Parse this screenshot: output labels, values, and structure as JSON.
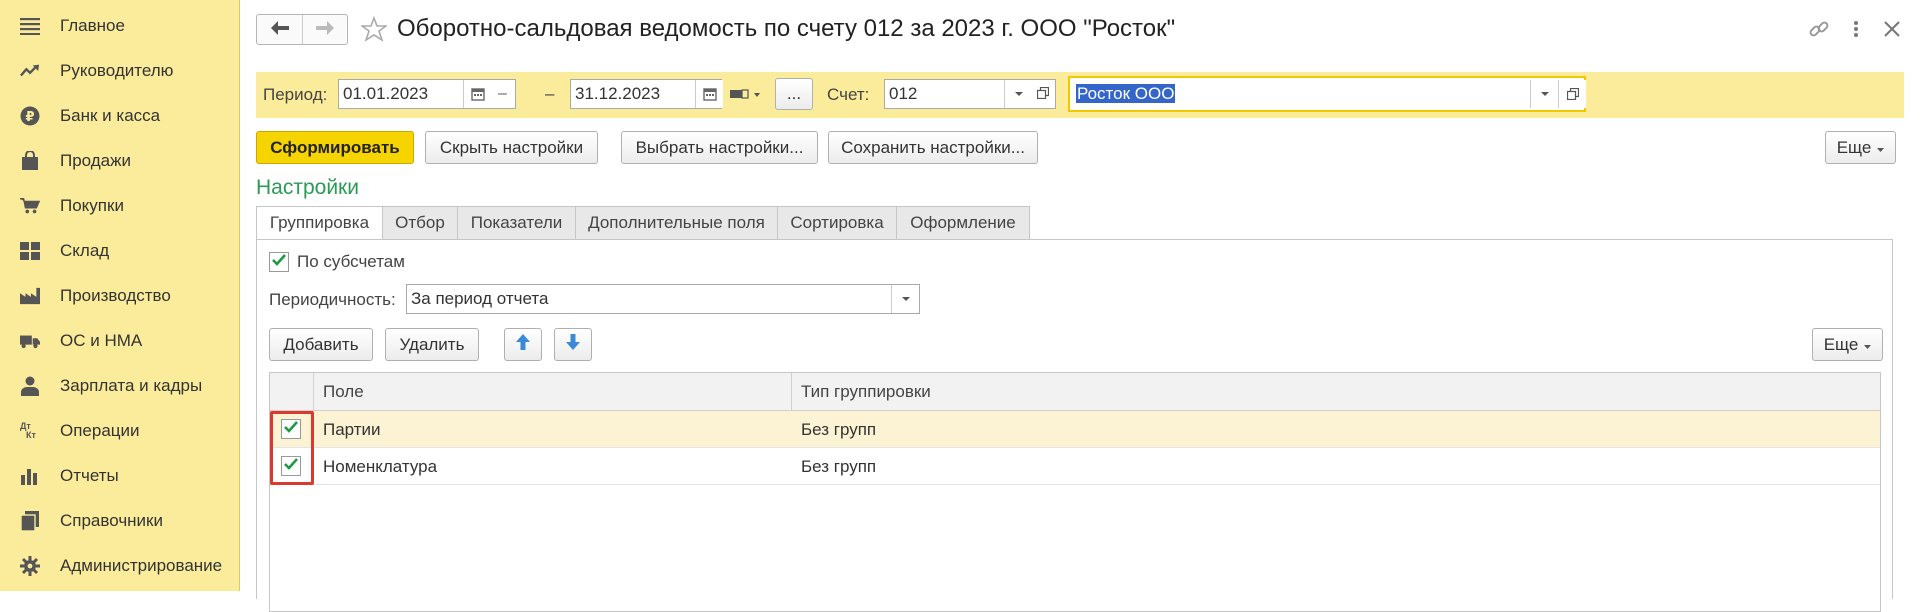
{
  "sidebar": {
    "items": [
      {
        "label": "Главное",
        "icon": "menu-lines-icon"
      },
      {
        "label": "Руководителю",
        "icon": "trend-up-icon"
      },
      {
        "label": "Банк и касса",
        "icon": "ruble-coin-icon"
      },
      {
        "label": "Продажи",
        "icon": "shopping-bag-icon"
      },
      {
        "label": "Покупки",
        "icon": "shopping-cart-icon"
      },
      {
        "label": "Склад",
        "icon": "warehouse-grid-icon"
      },
      {
        "label": "Производство",
        "icon": "factory-icon"
      },
      {
        "label": "ОС и НМА",
        "icon": "truck-icon"
      },
      {
        "label": "Зарплата и кадры",
        "icon": "person-icon"
      },
      {
        "label": "Операции",
        "icon": "dt-kt-icon"
      },
      {
        "label": "Отчеты",
        "icon": "bar-chart-icon"
      },
      {
        "label": "Справочники",
        "icon": "books-icon"
      },
      {
        "label": "Администрирование",
        "icon": "gear-icon"
      }
    ],
    "dt_label": "Дт",
    "kt_label": "Кт"
  },
  "header": {
    "title": "Оборотно-сальдовая ведомость по счету 012 за 2023 г. ООО \"Росток\""
  },
  "period": {
    "label": "Период:",
    "from": "01.01.2023",
    "dash": "–",
    "to": "31.12.2023",
    "ellipsis": "...",
    "account_label": "Счет:",
    "account": "012",
    "org": "Росток ООО"
  },
  "toolbar": {
    "generate": "Сформировать",
    "hide_settings": "Скрыть настройки",
    "choose_settings": "Выбрать настройки...",
    "save_settings": "Сохранить настройки...",
    "more": "Еще"
  },
  "settings": {
    "title": "Настройки",
    "tabs": [
      "Группировка",
      "Отбор",
      "Показатели",
      "Дополнительные поля",
      "Сортировка",
      "Оформление"
    ],
    "by_subaccounts": "По субсчетам",
    "periodicity_label": "Периодичность:",
    "periodicity_value": "За период отчета",
    "add": "Добавить",
    "delete": "Удалить",
    "more": "Еще"
  },
  "table": {
    "columns": [
      "Поле",
      "Тип группировки"
    ],
    "rows": [
      {
        "field": "Партии",
        "type": "Без групп",
        "checked": true
      },
      {
        "field": "Номенклатура",
        "type": "Без групп",
        "checked": true
      }
    ]
  },
  "colors": {
    "sidebar_bg": "#fbec9c",
    "primary_button": "#f6d400",
    "accent_green": "#2b9a55",
    "highlight_red": "#d9392e"
  }
}
